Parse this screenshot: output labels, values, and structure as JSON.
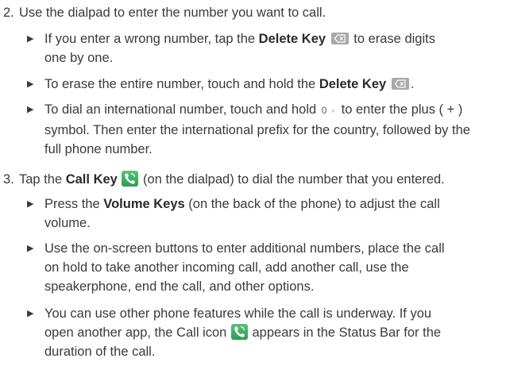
{
  "step2": {
    "number": "2.",
    "text": "Use the dialpad to enter the number you want to call."
  },
  "step2_bullets": [
    {
      "before": "If you enter a wrong number, tap the ",
      "key": "Delete Key",
      "after_line1": " to erase digits",
      "line2": "one by one."
    },
    {
      "before": "To erase the entire number, touch and hold the ",
      "key": "Delete Key",
      "after": "."
    },
    {
      "before": "To dial an international number, touch and hold ",
      "zero_label": "0",
      "zero_sub": "+",
      "after_line1": " to enter the plus ( + )",
      "line2": "symbol. Then enter the international prefix for the country, followed by the",
      "line3": "full phone number."
    }
  ],
  "step3": {
    "number": "3.",
    "before": "Tap the ",
    "key": "Call Key",
    "after": " (on the dialpad) to dial the number that you entered."
  },
  "step3_bullets": [
    {
      "before": "Press the ",
      "key": "Volume Keys",
      "after_line1": " (on the back of the phone) to adjust the call",
      "line2": "volume."
    },
    {
      "line1": "Use the on-screen buttons to enter additional numbers, place the call",
      "line2": "on hold to take another incoming call, add another call, use the",
      "line3": "speakerphone, end the call, and other options."
    },
    {
      "line1": "You can use other phone features while the call is underway. If you",
      "line2_before": "open another app, the Call icon ",
      "line2_after": " appears in the Status Bar for the",
      "line3": "duration of the call."
    }
  ],
  "icons": {
    "bullet": "triangle-right-icon",
    "delete": "delete-key-icon",
    "call": "call-key-icon"
  },
  "colors": {
    "text": "#3a3a3a",
    "call_key_green": "#3aa862",
    "delete_key_gray": "#a9a9a9"
  }
}
